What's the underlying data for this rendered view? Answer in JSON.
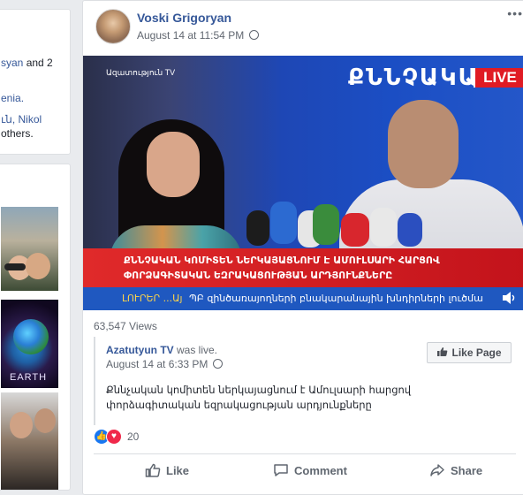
{
  "sidebar": {
    "top_lines": [
      {
        "link": "syan",
        "rest": " and 2"
      },
      {
        "link": "enia.",
        "rest": ""
      },
      {
        "link": "ւն, Nikol",
        "rest": ""
      },
      {
        "link": "",
        "rest": "others."
      }
    ],
    "earth_label": "EARTH"
  },
  "post": {
    "author": "Voski Grigoryan",
    "time": "August 14 at 11:54 PM",
    "more": "•••",
    "video": {
      "banner_text": "ՔՆՆՉԱԿԱ",
      "live_label": "LIVE",
      "channel_logo": "Ազատություն TV",
      "lower_third_line1": "ՔՆՆՉԱԿԱՆ ԿՈՄԻՏԵՆ ՆԵՐԿԱՅԱՑՆՈՒՄ Է ԱՄՈՒԼՍԱՐԻ ՀԱՐՑՈՎ",
      "lower_third_line2": "ՓՈՐՁԱԳԻՏԱԿԱՆ ԵԶՐԱԿԱՑՈՒԹՅԱՆ ԱՐԴՅՈՒՆՔՆԵՐԸ",
      "ticker_label": "ԼՈՒՐԵՐ ...Այ",
      "ticker_text": "ՊԲ զինծառայողների բնակարանային խնդիրների լուծմա"
    },
    "views": "63,547 Views",
    "shared": {
      "source_name": "Azatutyun TV",
      "source_suffix": " was live.",
      "time": "August 14 at 6:33 PM",
      "like_page_label": "Like Page",
      "text": "Քննչական կոմիտեն ներկայացնում է Ամուլսարի հարցով փորձագիտական եզրակացության արդյունքները"
    },
    "reaction_count": "20",
    "actions": {
      "like": "Like",
      "comment": "Comment",
      "share": "Share"
    }
  },
  "colors": {
    "link": "#365899",
    "meta": "#616770",
    "live_red": "#e01b24",
    "like_blue": "#1877f2",
    "love_red": "#f0284a"
  },
  "icons": [
    "globe-icon",
    "thumbs-up-icon",
    "comment-icon",
    "share-icon",
    "volume-icon",
    "heart-icon",
    "more-options-icon"
  ]
}
